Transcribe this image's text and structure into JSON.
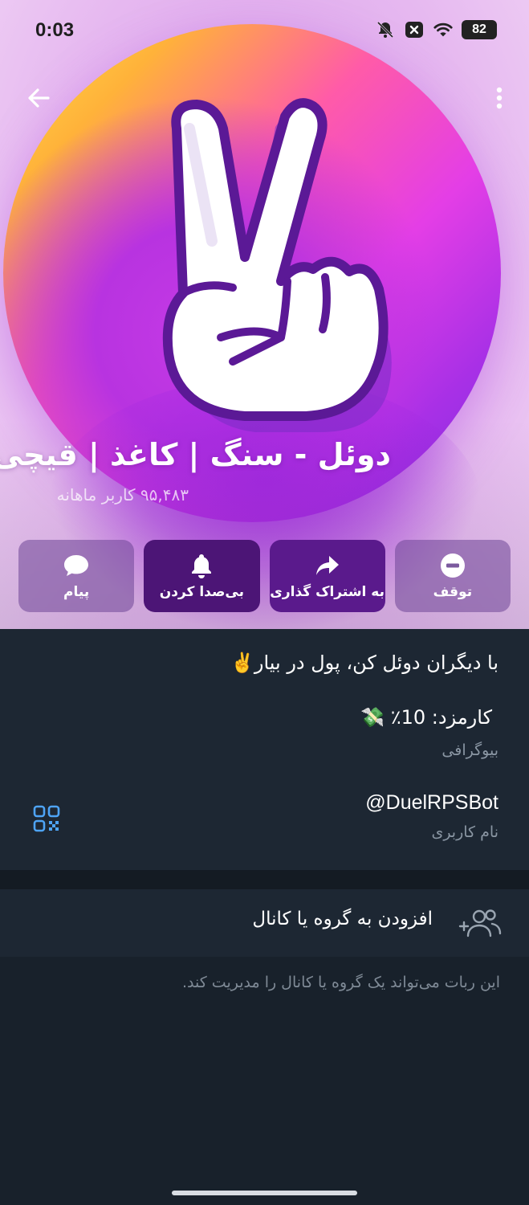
{
  "status_bar": {
    "time": "0:03",
    "battery": "82",
    "icons": [
      "bell-off-icon",
      "close-box-icon",
      "wifi-icon",
      "battery-icon"
    ]
  },
  "header": {
    "back_icon": "arrow-left-icon",
    "menu_icon": "more-vertical-icon"
  },
  "profile": {
    "title": "دوئل - سنگ | کاغذ | قیچی",
    "subtitle": "۹۵,۴۸۳ کاربر ماهانه"
  },
  "actions": [
    {
      "label": "پیام",
      "icon": "chat-bubble-icon"
    },
    {
      "label": "بی‌صدا کردن",
      "icon": "bell-icon"
    },
    {
      "label": "به اشتراک گذاری",
      "icon": "share-arrow-icon"
    },
    {
      "label": "توقف",
      "icon": "stop-circle-icon"
    }
  ],
  "info": {
    "description": "با دیگران دوئل کن، پول در بیار✌️",
    "fee": "کارمزد: 10٪ 💸",
    "fee_caption": "بیوگرافی",
    "username": "@DuelRPSBot",
    "username_caption": "نام کاربری",
    "qr_icon": "qr-code-icon"
  },
  "add_group": {
    "label": "افزودن به گروه یا کانال",
    "icon": "add-users-icon",
    "note": "این ربات می‌تواند یک گروه یا کانال را مدیریت کند."
  },
  "colors": {
    "background": "#18212b",
    "card": "#1d2733",
    "accent_purple": "#5a1a8c",
    "muted_text": "#8a96a3",
    "qr_blue": "#4ea4f6"
  }
}
